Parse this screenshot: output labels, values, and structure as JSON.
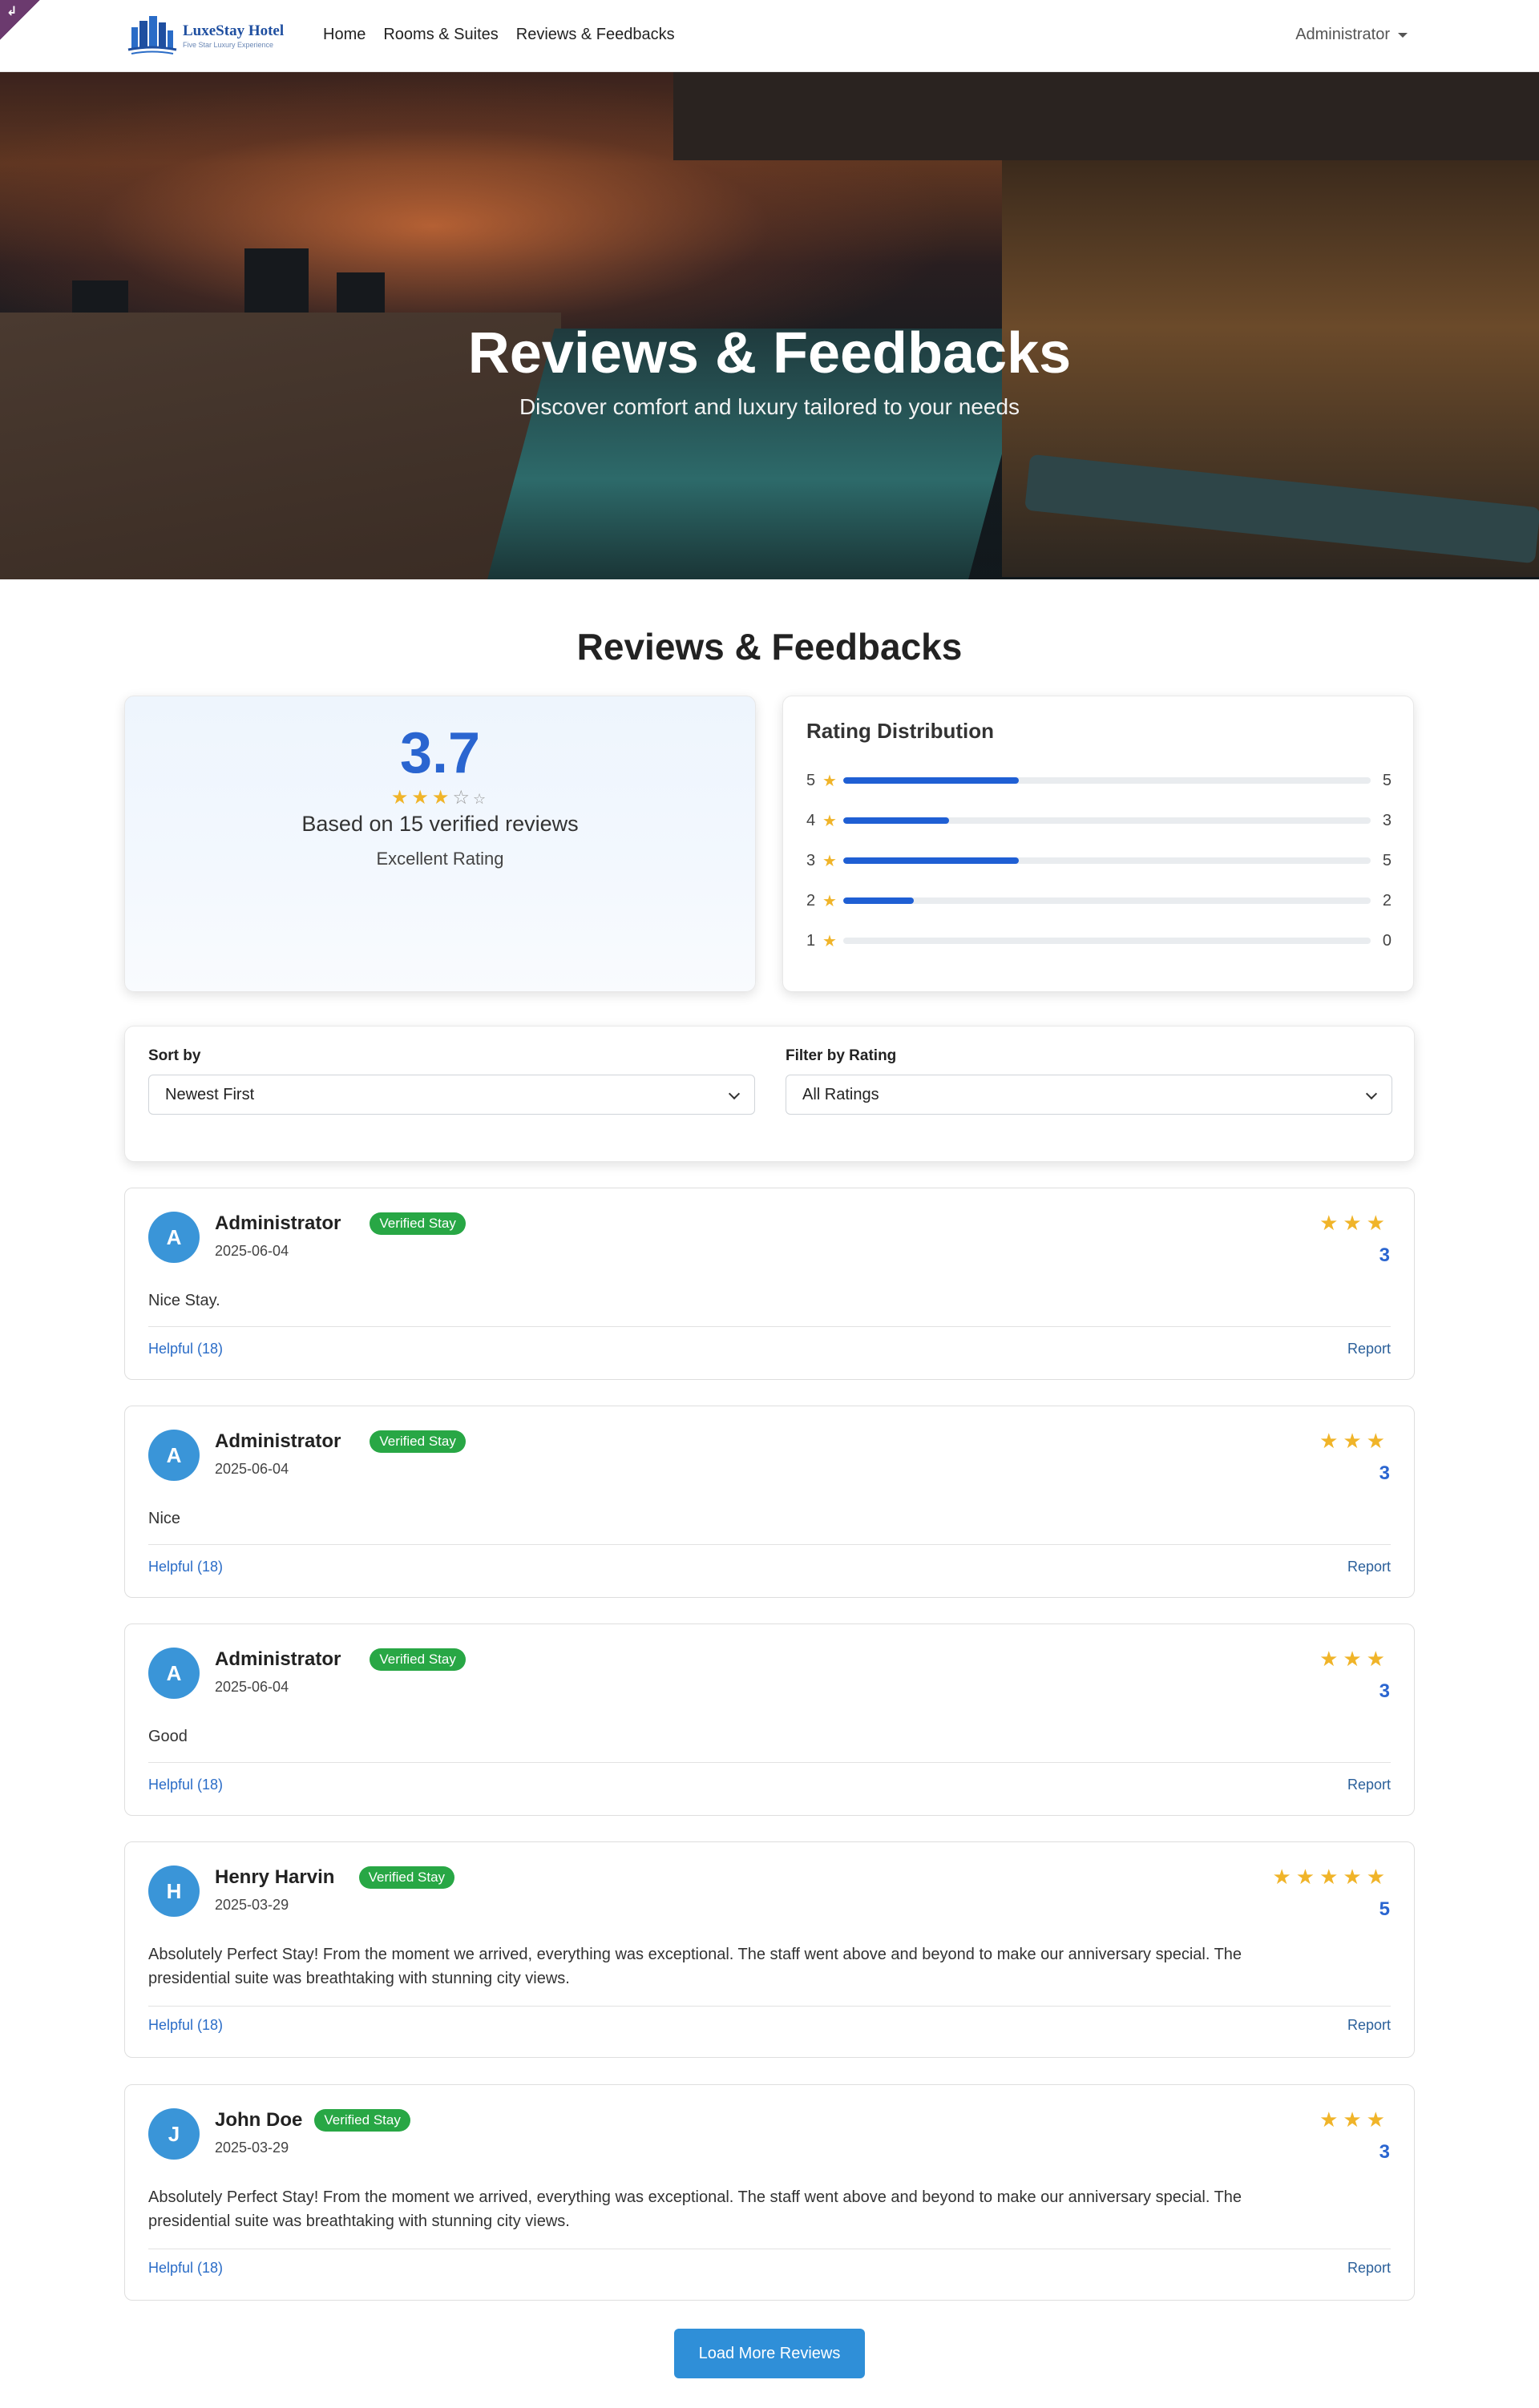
{
  "brand": {
    "name": "LuxeStay Hotel",
    "tagline": "Five Star Luxury Experience"
  },
  "nav": {
    "links": [
      "Home",
      "Rooms & Suites",
      "Reviews & Feedbacks"
    ],
    "user": "Administrator"
  },
  "hero": {
    "title": "Reviews & Feedbacks",
    "subtitle": "Discover comfort and luxury tailored to your needs"
  },
  "section_title": "Reviews & Feedbacks",
  "summary": {
    "average": "3.7",
    "based_on": "Based on 15 verified reviews",
    "label": "Excellent Rating"
  },
  "distribution": {
    "title": "Rating Distribution",
    "rows": [
      {
        "stars": "5",
        "count": "5",
        "fraction": 0.333
      },
      {
        "stars": "4",
        "count": "3",
        "fraction": 0.2
      },
      {
        "stars": "3",
        "count": "5",
        "fraction": 0.333
      },
      {
        "stars": "2",
        "count": "2",
        "fraction": 0.133
      },
      {
        "stars": "1",
        "count": "0",
        "fraction": 0
      }
    ]
  },
  "filters": {
    "sort_label": "Sort by",
    "sort_value": "Newest First",
    "filter_label": "Filter by Rating",
    "filter_value": "All Ratings"
  },
  "reviews": [
    {
      "initial": "A",
      "name": "Administrator",
      "badge": "Verified Stay",
      "date": "2025-06-04",
      "stars": "★★★",
      "score": "3",
      "text": "Nice Stay.",
      "helpful": "Helpful (18)",
      "report": "Report"
    },
    {
      "initial": "A",
      "name": "Administrator",
      "badge": "Verified Stay",
      "date": "2025-06-04",
      "stars": "★★★",
      "score": "3",
      "text": "Nice",
      "helpful": "Helpful (18)",
      "report": "Report"
    },
    {
      "initial": "A",
      "name": "Administrator",
      "badge": "Verified Stay",
      "date": "2025-06-04",
      "stars": "★★★",
      "score": "3",
      "text": "Good",
      "helpful": "Helpful (18)",
      "report": "Report"
    },
    {
      "initial": "H",
      "name": "Henry Harvin",
      "badge": "Verified Stay",
      "date": "2025-03-29",
      "stars": "★★★★★",
      "score": "5",
      "text": "Absolutely Perfect Stay! From the moment we arrived, everything was exceptional. The staff went above and beyond to make our anniversary special. The presidential suite was breathtaking with stunning city views.",
      "helpful": "Helpful (18)",
      "report": "Report"
    },
    {
      "initial": "J",
      "name": "John Doe",
      "badge": "Verified Stay",
      "date": "2025-03-29",
      "stars": "★★★",
      "score": "3",
      "text": "Absolutely Perfect Stay! From the moment we arrived, everything was exceptional. The staff went above and beyond to make our anniversary special. The presidential suite was breathtaking with stunning city views.",
      "helpful": "Helpful (18)",
      "report": "Report"
    }
  ],
  "load_more": "Load More Reviews",
  "colors": {
    "accent": "#2a65d0",
    "star": "#f0b429",
    "verified": "#28a745",
    "button": "#2f8fd8",
    "avatar": "#3a95d8"
  }
}
